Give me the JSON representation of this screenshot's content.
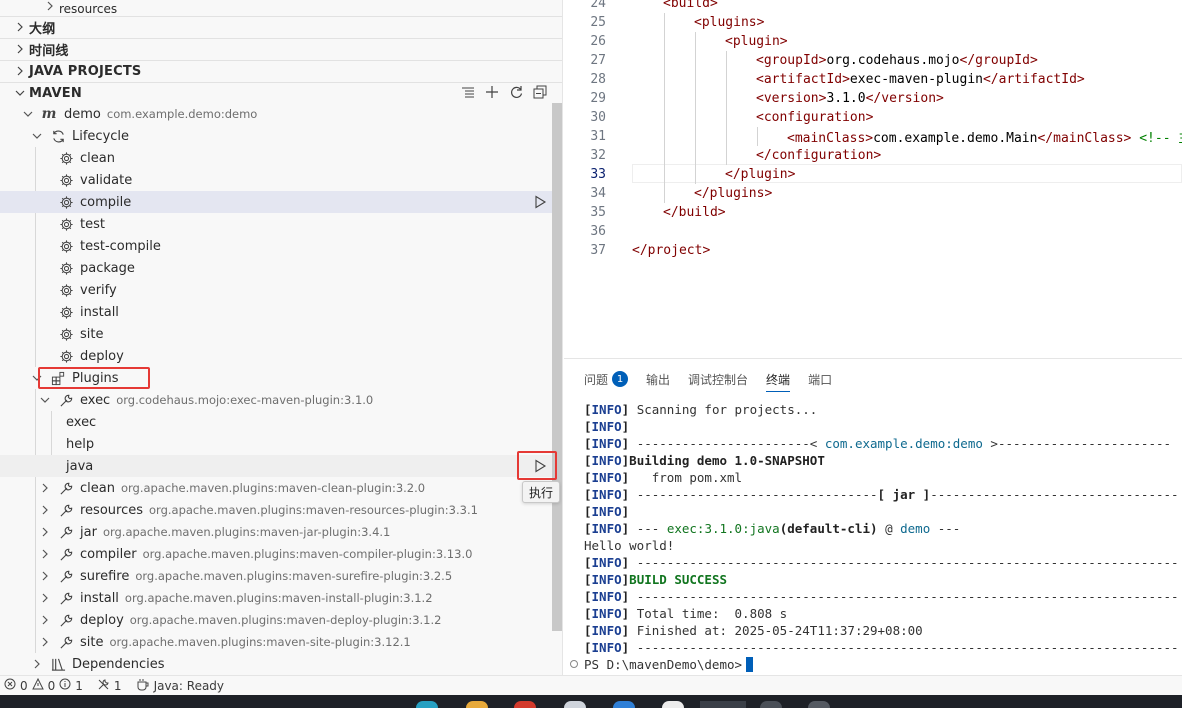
{
  "sidebar": {
    "partial_top_item": "resources",
    "sections": {
      "outline": "大纲",
      "timeline": "时间线",
      "java_projects": "JAVA PROJECTS",
      "maven": "MAVEN"
    },
    "maven_actions": [
      "list-flat-icon",
      "add-icon",
      "refresh-icon",
      "collapse-all-icon"
    ],
    "project": {
      "name": "demo",
      "desc": "com.example.demo:demo"
    },
    "lifecycle": {
      "label": "Lifecycle",
      "phases": [
        "clean",
        "validate",
        "compile",
        "test",
        "test-compile",
        "package",
        "verify",
        "install",
        "site",
        "deploy"
      ],
      "selected": "compile"
    },
    "plugins": {
      "label": "Plugins",
      "exec": {
        "name": "exec",
        "desc": "org.codehaus.mojo:exec-maven-plugin:3.1.0",
        "goals": [
          "exec",
          "help",
          "java"
        ]
      },
      "others": [
        {
          "name": "clean",
          "desc": "org.apache.maven.plugins:maven-clean-plugin:3.2.0"
        },
        {
          "name": "resources",
          "desc": "org.apache.maven.plugins:maven-resources-plugin:3.3.1"
        },
        {
          "name": "jar",
          "desc": "org.apache.maven.plugins:maven-jar-plugin:3.4.1"
        },
        {
          "name": "compiler",
          "desc": "org.apache.maven.plugins:maven-compiler-plugin:3.13.0"
        },
        {
          "name": "surefire",
          "desc": "org.apache.maven.plugins:maven-surefire-plugin:3.2.5"
        },
        {
          "name": "install",
          "desc": "org.apache.maven.plugins:maven-install-plugin:3.1.2"
        },
        {
          "name": "deploy",
          "desc": "org.apache.maven.plugins:maven-deploy-plugin:3.1.2"
        },
        {
          "name": "site",
          "desc": "org.apache.maven.plugins:maven-site-plugin:3.12.1"
        }
      ]
    },
    "dependencies": {
      "label": "Dependencies"
    },
    "run_tooltip": "执行"
  },
  "editor": {
    "current_line": 33,
    "lines": [
      {
        "n": 24,
        "indent": 1,
        "code": "<build>"
      },
      {
        "n": 25,
        "indent": 2,
        "code": "<plugins>"
      },
      {
        "n": 26,
        "indent": 3,
        "code": "<plugin>"
      },
      {
        "n": 27,
        "indent": 4,
        "code": "<groupId>org.codehaus.mojo</groupId>"
      },
      {
        "n": 28,
        "indent": 4,
        "code": "<artifactId>exec-maven-plugin</artifactId>"
      },
      {
        "n": 29,
        "indent": 4,
        "code": "<version>3.1.0</version>"
      },
      {
        "n": 30,
        "indent": 4,
        "code": "<configuration>"
      },
      {
        "n": 31,
        "indent": 5,
        "code": "<mainClass>com.example.demo.Main</mainClass> <!-- 主"
      },
      {
        "n": 32,
        "indent": 4,
        "code": "</configuration>"
      },
      {
        "n": 33,
        "indent": 3,
        "code": "</plugin>"
      },
      {
        "n": 34,
        "indent": 2,
        "code": "</plugins>"
      },
      {
        "n": 35,
        "indent": 1,
        "code": "</build>"
      },
      {
        "n": 36,
        "indent": 0,
        "code": ""
      },
      {
        "n": 37,
        "indent": 0,
        "code": "</project>"
      }
    ]
  },
  "panel": {
    "tabs": [
      {
        "label": "问题",
        "badge": "1"
      },
      {
        "label": "输出"
      },
      {
        "label": "调试控制台"
      },
      {
        "label": "终端",
        "active": true
      },
      {
        "label": "端口"
      }
    ],
    "terminal": [
      "[INFO] Scanning for projects...",
      "[INFO]",
      "[INFO] -----------------------< com.example.demo:demo >-----------------------",
      "[INFO] Building demo 1.0-SNAPSHOT",
      "[INFO]   from pom.xml",
      "[INFO] --------------------------------[ jar ]---------------------------------",
      "[INFO]",
      "[INFO] --- exec:3.1.0:java (default-cli) @ demo ---",
      "Hello world!",
      "[INFO] ------------------------------------------------------------------------",
      "[INFO] BUILD SUCCESS",
      "[INFO] ------------------------------------------------------------------------",
      "[INFO] Total time:  0.808 s",
      "[INFO] Finished at: 2025-05-24T11:37:29+08:00",
      "[INFO] ------------------------------------------------------------------------",
      "PS D:\\mavenDemo\\demo>"
    ]
  },
  "statusbar": {
    "errors": "0",
    "warnings": "0",
    "infos": "1",
    "ports": "1",
    "java_status": "Java: Ready"
  }
}
